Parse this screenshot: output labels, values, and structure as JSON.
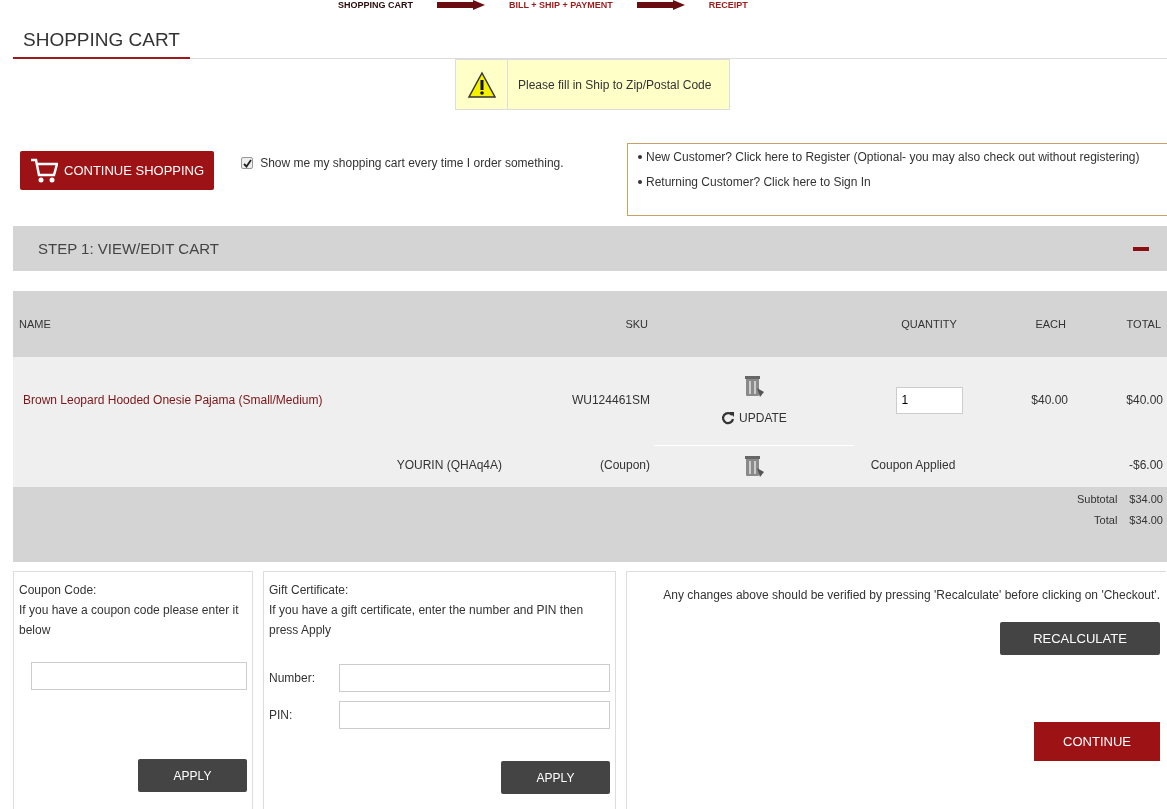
{
  "progress": [
    {
      "label": "SHOPPING CART",
      "selected": true
    },
    {
      "label": "BILL + SHIP + PAYMENT",
      "selected": false
    },
    {
      "label": "RECEIPT",
      "selected": false
    }
  ],
  "page_title": "SHOPPING CART",
  "alert": "Please fill in Ship to Zip/Postal Code",
  "continue_shopping": "CONTINUE SHOPPING",
  "show_cart": {
    "label": "Show me my shopping cart every time I order something.",
    "checked": true
  },
  "account_links": [
    "New Customer? Click here to Register (Optional- you may also check out without registering)",
    "Returning Customer? Click here to Sign In"
  ],
  "step": {
    "title": "STEP 1: VIEW/EDIT CART",
    "expanded": true
  },
  "table": {
    "columns": [
      "NAME",
      "SKU",
      "QUANTITY",
      "EACH",
      "TOTAL"
    ],
    "rows": [
      {
        "kind": "item",
        "name": "Brown Leopard Hooded Onesie Pajama (Small/Medium)",
        "sku": "WU124461SM",
        "update": "UPDATE",
        "quantity": "1",
        "each": "$40.00",
        "total": "$40.00"
      },
      {
        "kind": "coupon",
        "name": "YOURIN (QHAq4A)",
        "sku": "(Coupon)",
        "quantity": "Coupon Applied",
        "total": "-$6.00"
      }
    ],
    "summary": [
      {
        "label": "Subtotal",
        "value": "$34.00"
      },
      {
        "label": "Total",
        "value": "$34.00"
      }
    ]
  },
  "coupon": {
    "title": "Coupon Code:",
    "hint": "If you have a coupon code please enter it below",
    "button": "APPLY"
  },
  "gift": {
    "title": "Gift Certificate:",
    "hint": "If you have a gift certificate, enter the number and PIN then press Apply",
    "fields": [
      "Number:",
      "PIN:"
    ],
    "button": "APPLY"
  },
  "checkout": {
    "note": "Any changes above should be verified by pressing 'Recalculate' before clicking on 'Checkout'.",
    "recalculate": "RECALCULATE",
    "continue": "CONTINUE"
  }
}
